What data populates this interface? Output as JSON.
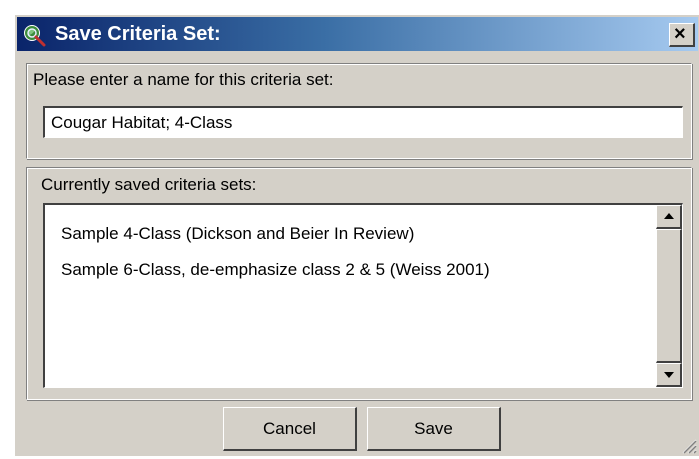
{
  "window": {
    "title": "Save Criteria Set:",
    "close_glyph": "×"
  },
  "name_group": {
    "label": "Please enter a name for this criteria set:",
    "input_value": "Cougar Habitat; 4-Class"
  },
  "saved_group": {
    "label": "Currently saved criteria sets:",
    "items": [
      {
        "label": "Sample 4-Class (Dickson and Beier In Review)"
      },
      {
        "label": "Sample 6-Class, de-emphasize class 2 & 5 (Weiss 2001)"
      }
    ]
  },
  "buttons": {
    "cancel_label": "Cancel",
    "save_label": "Save"
  },
  "icons": {
    "app": "globe-magnifier-icon",
    "close": "close-icon",
    "scroll_up": "scroll-up-arrow-icon",
    "scroll_down": "scroll-down-arrow-icon",
    "resize": "resize-grip-icon"
  },
  "colors": {
    "title_gradient_start": "#0a246a",
    "title_gradient_end": "#a6caf0",
    "dialog_face": "#d4d0c8"
  }
}
